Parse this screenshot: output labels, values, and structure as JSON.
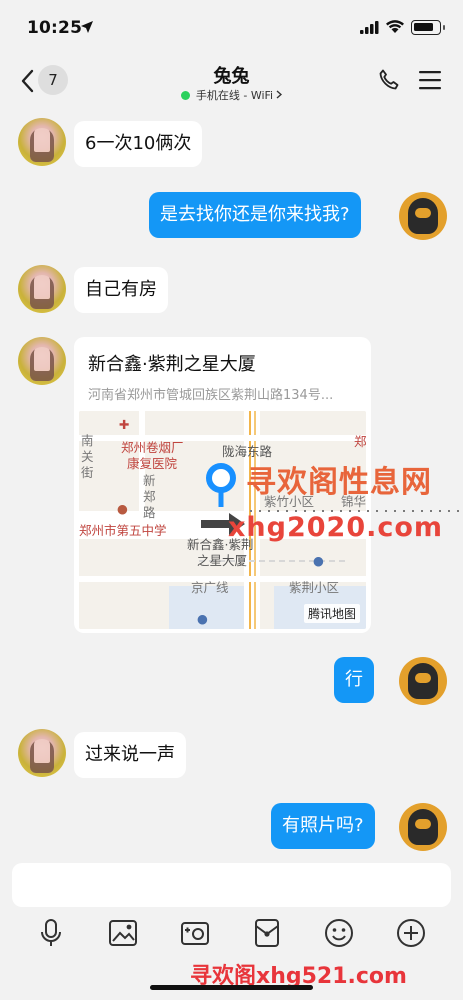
{
  "status_bar": {
    "time": "10:25"
  },
  "header": {
    "back_count": "7",
    "contact_name": "兔兔",
    "contact_status": "手机在线 - WiFi"
  },
  "messages": [
    {
      "side": "in",
      "text": "6一次10俩次"
    },
    {
      "side": "out",
      "text": "是去找你还是你来找我?"
    },
    {
      "side": "in",
      "text": "自己有房"
    },
    {
      "side": "in",
      "type": "location"
    },
    {
      "side": "out",
      "text": "行"
    },
    {
      "side": "in",
      "text": "过来说一声"
    },
    {
      "side": "out",
      "text": "有照片吗?"
    }
  ],
  "location": {
    "title": "新合鑫·紫荆之星大厦",
    "address": "河南省郑州市管城回族区紫荆山路134号...",
    "map_labels": {
      "road_south_guan": "南关街",
      "hospital": "郑州卷烟厂",
      "hospital2": "康复医院",
      "road_longhai": "陇海东路",
      "zheng": "郑",
      "road_xinzheng": "新郑路",
      "zizhu": "紫竹小区",
      "jinhua": "锦华",
      "school": "郑州市第五中学",
      "building": "新合鑫·紫荆",
      "building2": "之星大厦",
      "jingguang": "京广线",
      "zijing": "紫荆小区"
    },
    "provider": "腾讯地图"
  },
  "watermarks": {
    "top": "寻欢阁性息网",
    "middle": "xhg2020.com",
    "bottom": "寻欢阁xhg521.com"
  },
  "input": {
    "placeholder": ""
  },
  "toolbar_icons": [
    "microphone-icon",
    "image-icon",
    "camera-icon",
    "red-packet-icon",
    "emoji-icon",
    "plus-icon"
  ],
  "colors": {
    "bubble_out": "#1497f6",
    "online": "#2bd15d"
  }
}
